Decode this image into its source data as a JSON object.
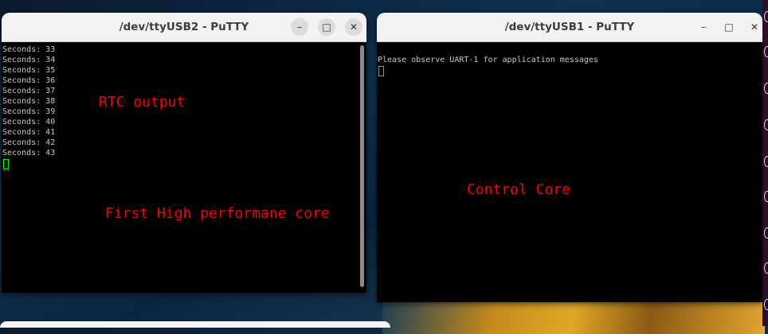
{
  "windows": [
    {
      "title": "/dev/ttyUSB2 - PuTTY",
      "lines": [
        "Seconds: 33",
        "Seconds: 34",
        "Seconds: 35",
        "Seconds: 36",
        "Seconds: 37",
        "Seconds: 38",
        "Seconds: 39",
        "Seconds: 40",
        "Seconds: 41",
        "Seconds: 42",
        "Seconds: 43"
      ],
      "annotations": [
        "RTC output",
        "First High performane core"
      ]
    },
    {
      "title": "/dev/ttyUSB1 - PuTTY",
      "lines": [
        "",
        "Please observe UART-1 for application messages"
      ],
      "annotations": [
        "Control Core"
      ]
    }
  ],
  "buttons": {
    "minimize": "–",
    "maximize": "□",
    "close": "✕"
  },
  "colors": {
    "annotation": "#ff0000",
    "cursor": "#00ff00",
    "terminal_bg": "#000000"
  }
}
